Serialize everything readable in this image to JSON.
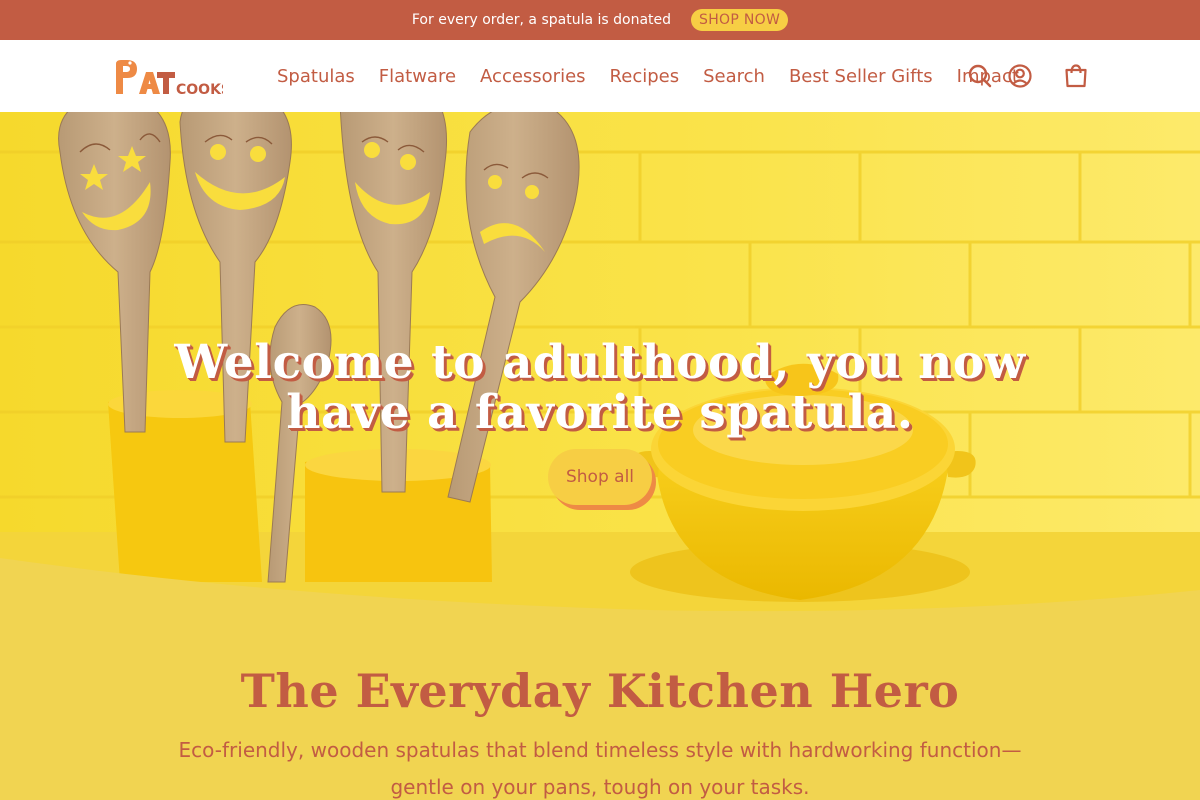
{
  "announcement": {
    "text": "For every order, a spatula is donated",
    "button_label": "SHOP NOW"
  },
  "header": {
    "logo_icon": "patcooks-logo",
    "logo_text": "PATCOOKS",
    "nav": [
      {
        "label": "Spatulas"
      },
      {
        "label": "Flatware"
      },
      {
        "label": "Accessories"
      },
      {
        "label": "Recipes"
      },
      {
        "label": "Search"
      },
      {
        "label": "Best Seller Gifts"
      },
      {
        "label": "Impact"
      }
    ],
    "icons": [
      "search-icon",
      "account-icon",
      "cart-icon"
    ]
  },
  "hero": {
    "title": "Welcome to adulthood, you now have a favorite spatula.",
    "button_label": "Shop all"
  },
  "section": {
    "title": "The Everyday Kitchen Hero",
    "text": "Eco-friendly, wooden spatulas that blend timeless style with hardworking function—gentle on your pans, tough on your tasks."
  },
  "colors": {
    "accent": "#c25c43",
    "announcement_bg": "#c25c43",
    "button_yellow": "#f7ce44",
    "section_bg": "#f1d451",
    "hero_bg": "#f9dd3d"
  }
}
